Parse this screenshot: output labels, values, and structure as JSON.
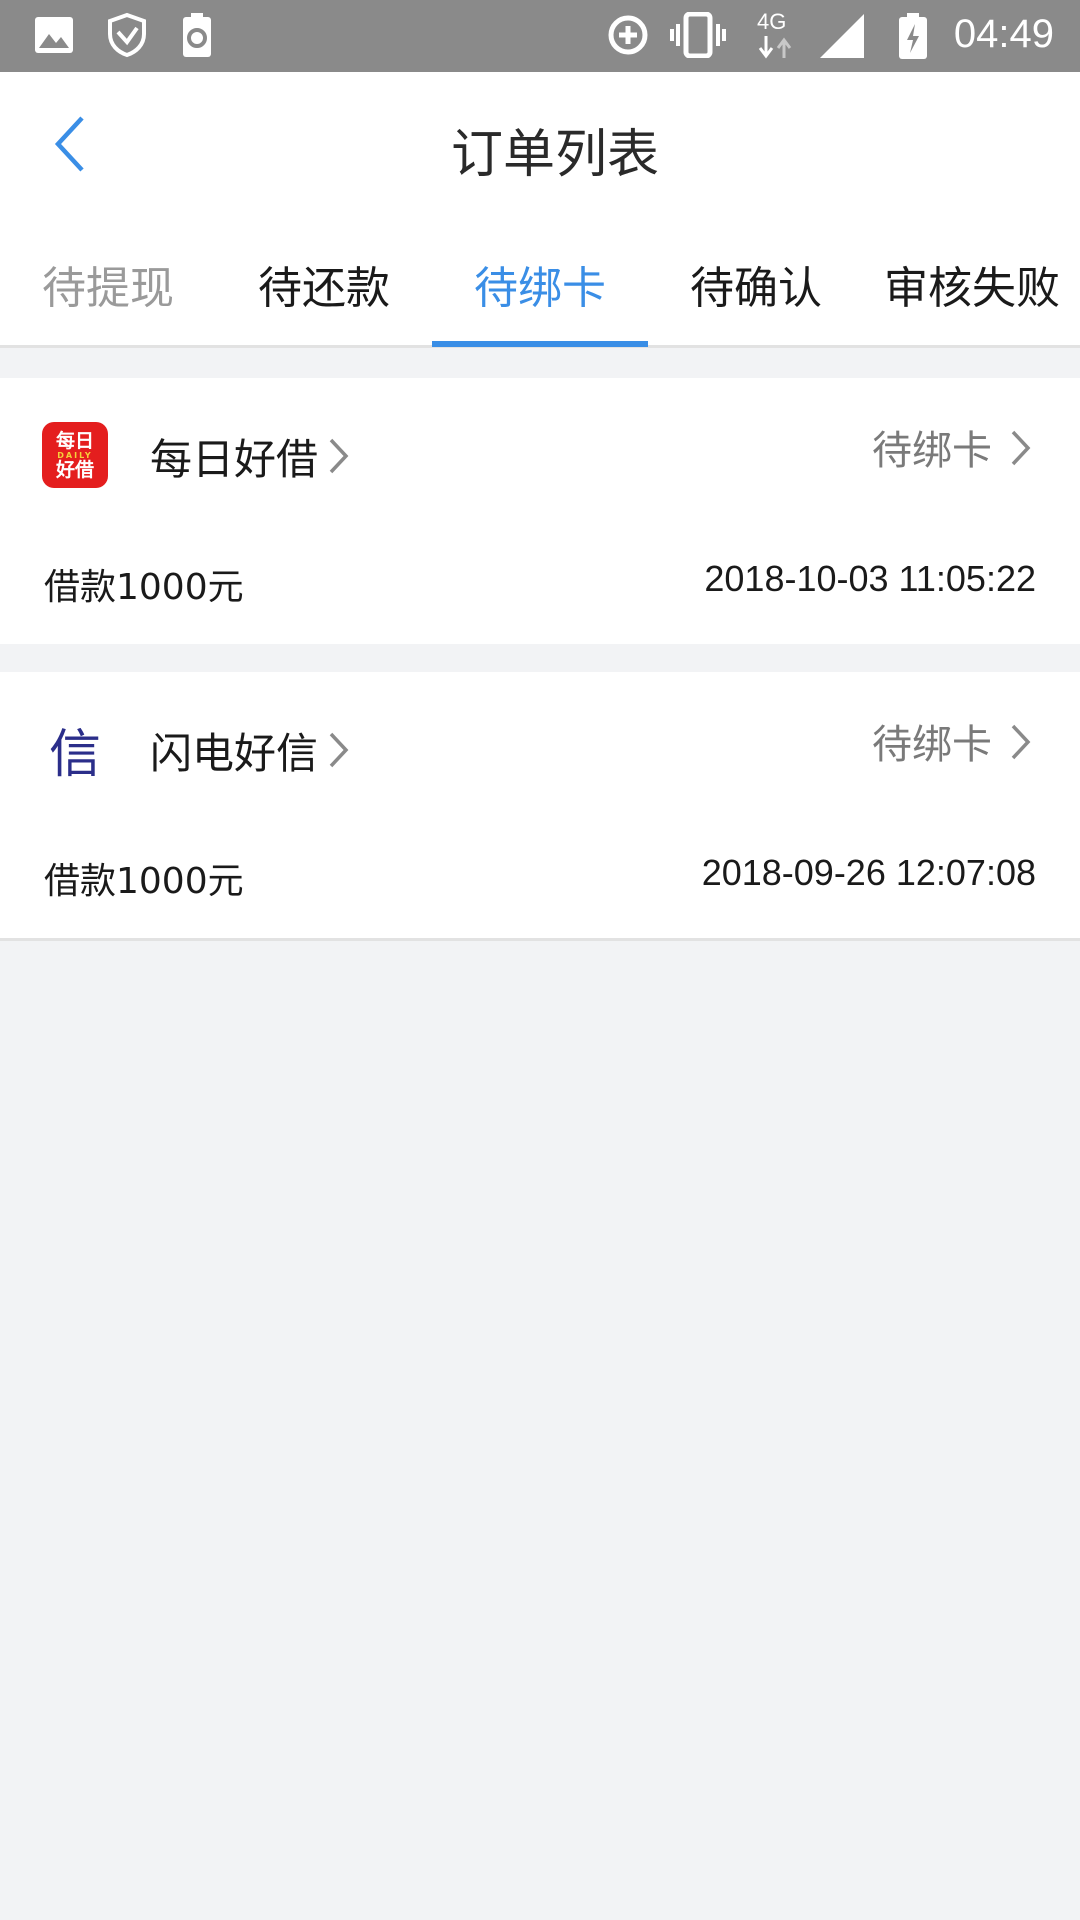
{
  "status_bar": {
    "time": "04:49",
    "network": "4G",
    "icons": [
      "image-icon",
      "shield-icon",
      "battery-saver-icon",
      "sync-icon",
      "vibrate-icon",
      "data-arrows-icon",
      "signal-icon",
      "battery-charging-icon"
    ]
  },
  "header": {
    "title": "订单列表",
    "back_icon": "chevron-left-icon"
  },
  "tabs": [
    {
      "label": "待提现"
    },
    {
      "label": "待还款"
    },
    {
      "label": "待绑卡"
    },
    {
      "label": "待确认"
    },
    {
      "label": "审核失败"
    }
  ],
  "active_tab": "待绑卡",
  "colors": {
    "accent": "#3a8ee6",
    "background": "#f2f3f5",
    "status_bar": "#8a8a8a",
    "status_text": "#7a7a7a"
  },
  "orders": [
    {
      "lender": "每日好借",
      "logo_text_top": "每日",
      "logo_text_mid": "DAILY",
      "logo_text_bottom": "好借",
      "status": "待绑卡",
      "amount": "借款1000元",
      "date": "2018-10-03 11:05:22"
    },
    {
      "lender": "闪电好信",
      "logo_text": "信",
      "status": "待绑卡",
      "amount": "借款1000元",
      "date": "2018-09-26 12:07:08"
    }
  ]
}
